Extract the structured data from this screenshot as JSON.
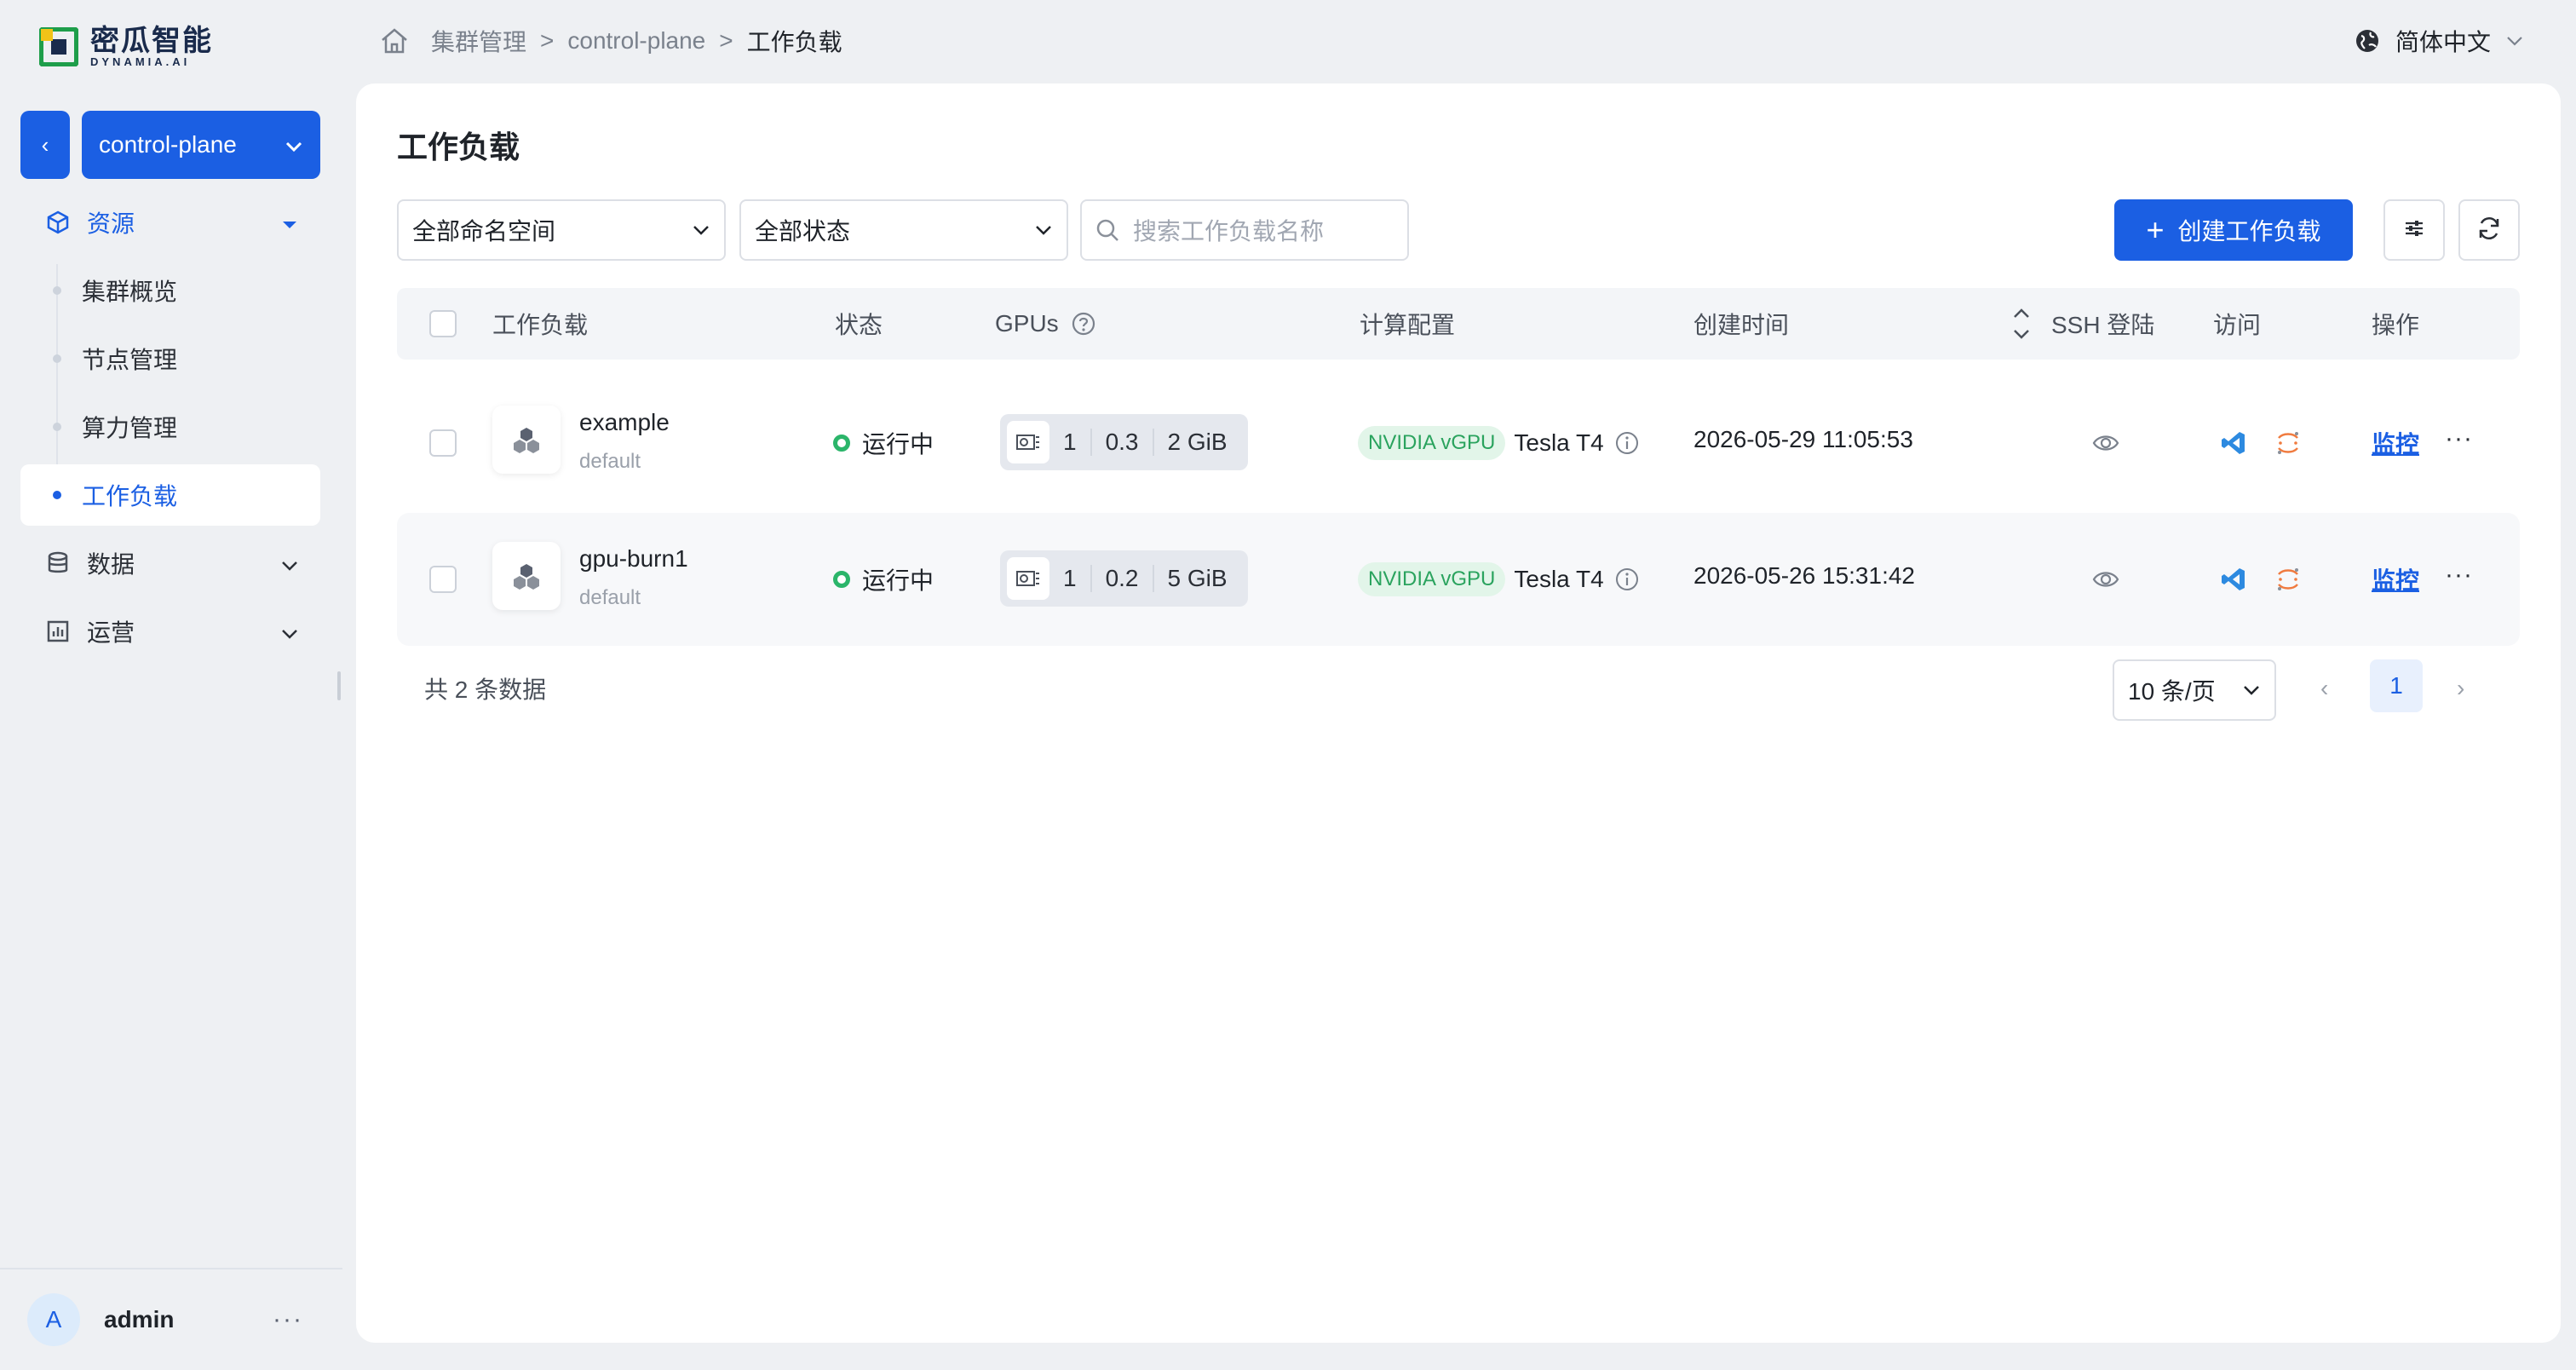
{
  "brand": {
    "name_cn": "密瓜智能",
    "name_en": "DYNAMIA.AI"
  },
  "cluster": {
    "back_label": "‹",
    "selected": "control-plane"
  },
  "sidebar": {
    "groups": [
      {
        "label": "资源",
        "icon": "cube-icon",
        "expanded": true
      },
      {
        "label": "数据",
        "icon": "database-icon",
        "expanded": false
      },
      {
        "label": "运营",
        "icon": "bar-chart-icon",
        "expanded": false
      }
    ],
    "items": [
      {
        "label": "集群概览"
      },
      {
        "label": "节点管理"
      },
      {
        "label": "算力管理"
      },
      {
        "label": "工作负载",
        "active": true
      }
    ]
  },
  "user": {
    "avatar_letter": "A",
    "name": "admin",
    "more": "···"
  },
  "breadcrumb": {
    "items": [
      "集群管理",
      "control-plane",
      "工作负载"
    ],
    "separator": ">"
  },
  "language": {
    "label": "简体中文"
  },
  "page": {
    "title": "工作负载"
  },
  "filters": {
    "namespace": "全部命名空间",
    "status": "全部状态",
    "search_placeholder": "搜索工作负载名称"
  },
  "toolbar": {
    "create_label": "创建工作负载",
    "create_icon": "+"
  },
  "table": {
    "columns": [
      "工作负载",
      "状态",
      "GPUs",
      "计算配置",
      "创建时间",
      "SSH 登陆",
      "访问",
      "操作"
    ],
    "rows": [
      {
        "name": "example",
        "namespace": "default",
        "status": "运行中",
        "gpu_count": "1",
        "gpu_compute": "0.3",
        "gpu_memory": "2 GiB",
        "vendor_badge": "NVIDIA vGPU",
        "gpu_model": "Tesla T4",
        "created": "2026-05-29 11:05:53",
        "action": "监控",
        "more": "···"
      },
      {
        "name": "gpu-burn1",
        "namespace": "default",
        "status": "运行中",
        "gpu_count": "1",
        "gpu_compute": "0.2",
        "gpu_memory": "5 GiB",
        "vendor_badge": "NVIDIA vGPU",
        "gpu_model": "Tesla T4",
        "created": "2026-05-26 15:31:42",
        "action": "监控",
        "more": "···"
      }
    ]
  },
  "pagination": {
    "total_text": "共 2 条数据",
    "page_size": "10 条/页",
    "current_page": "1",
    "prev": "‹",
    "next": "›"
  },
  "colors": {
    "primary": "#1b5fe3",
    "success": "#2bb56a",
    "vgpu_badge_bg": "#e2f5e9"
  }
}
